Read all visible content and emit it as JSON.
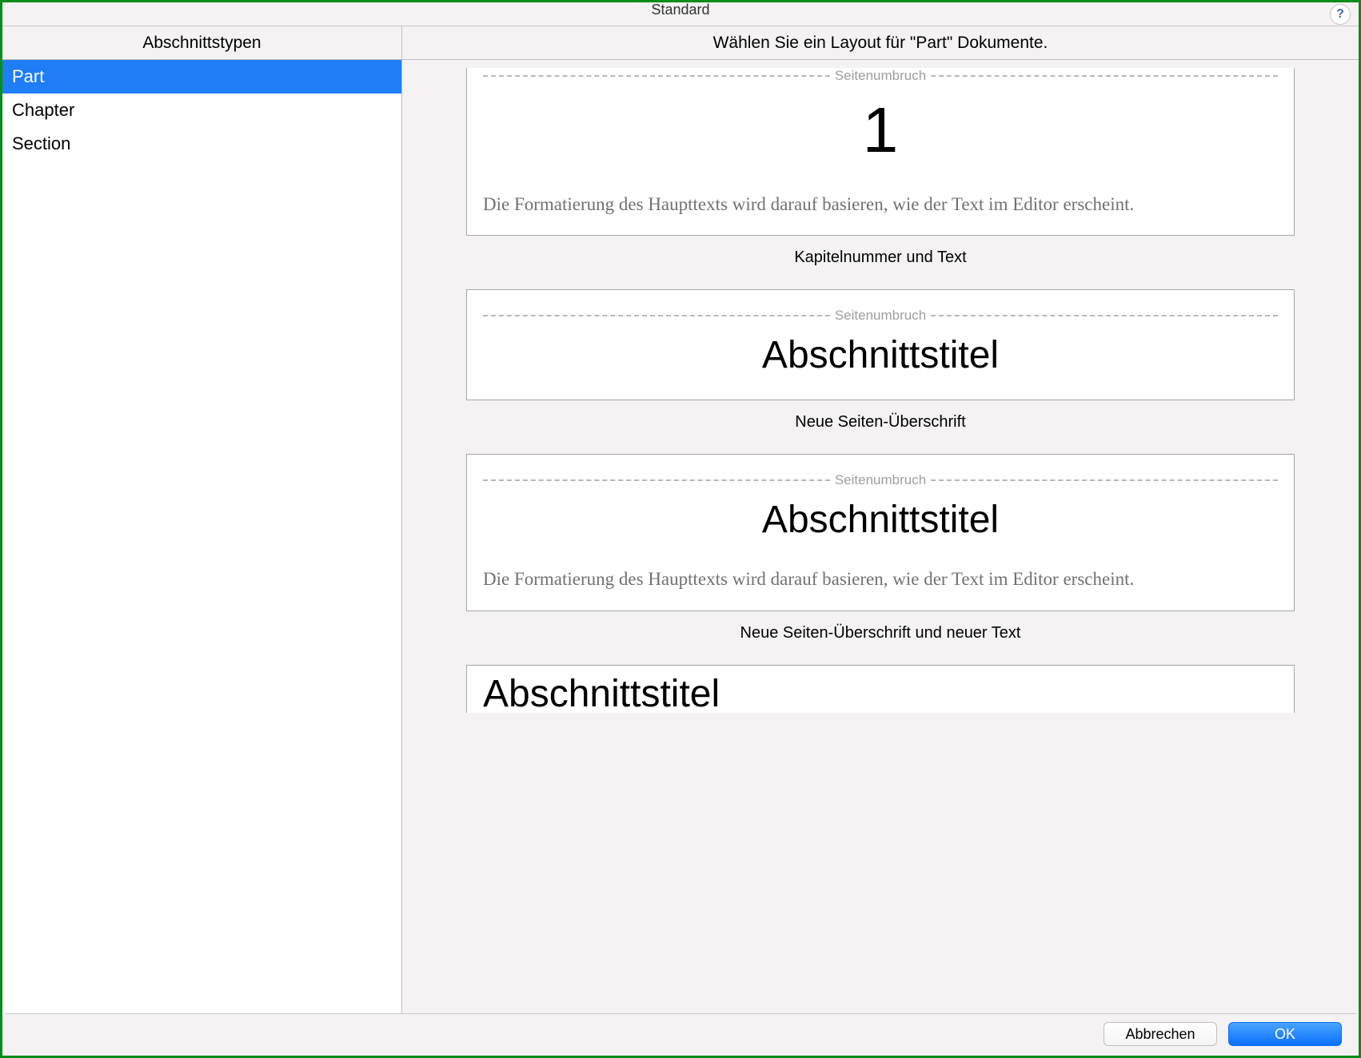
{
  "titlebar": {
    "title": "Standard",
    "help": "?"
  },
  "headers": {
    "left": "Abschnittstypen",
    "right": "Wählen Sie ein Layout für \"Part\" Dokumente."
  },
  "sidebar": {
    "items": [
      {
        "label": "Part",
        "selected": true
      },
      {
        "label": "Chapter",
        "selected": false
      },
      {
        "label": "Section",
        "selected": false
      }
    ]
  },
  "layouts": {
    "pagebreak_label": "Seitenumbruch",
    "body_sample": "Die Formatierung des Haupttexts wird darauf basieren, wie der Text im Editor erscheint.",
    "cards": [
      {
        "number": "1",
        "has_body": true,
        "caption": "Kapitelnummer und Text"
      },
      {
        "title": "Abschnittstitel",
        "has_body": false,
        "caption": "Neue Seiten-Überschrift"
      },
      {
        "title": "Abschnittstitel",
        "has_body": true,
        "caption": "Neue Seiten-Überschrift und neuer Text"
      }
    ],
    "peek_title": "Abschnittstitel"
  },
  "footer": {
    "cancel": "Abbrechen",
    "ok": "OK"
  }
}
